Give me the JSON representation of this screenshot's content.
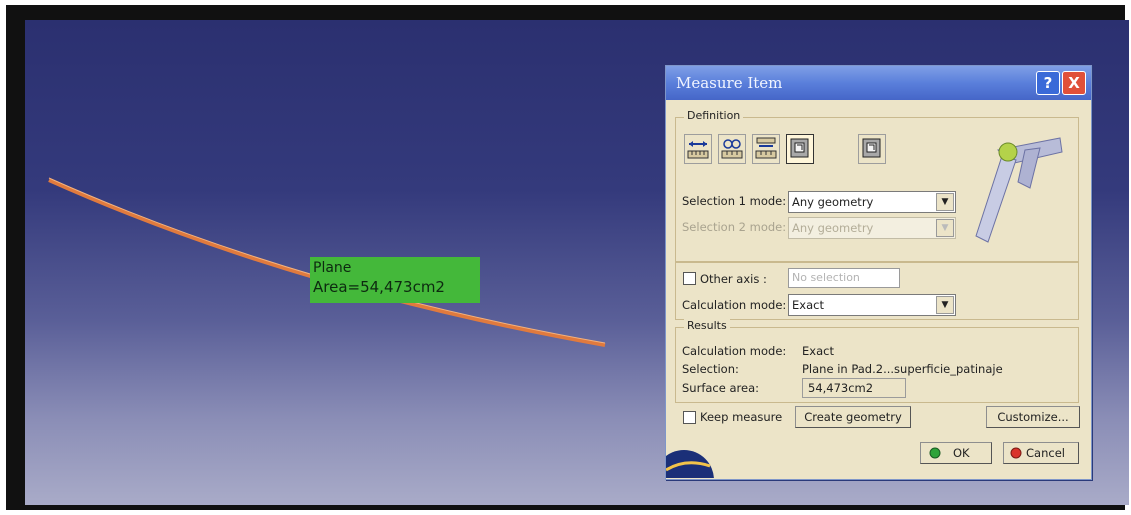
{
  "viewport": {
    "label": {
      "line1": "Plane",
      "line2": "Area=54,473cm2"
    }
  },
  "dialog": {
    "title": "Measure Item",
    "help_icon": "?",
    "close_icon": "X",
    "definition": {
      "legend": "Definition",
      "tools": [
        "measure-between-icon",
        "measure-item-icon",
        "measure-thickness-icon",
        "measure-surface-icon",
        "measure-inertia-icon"
      ],
      "selection1_label": "Selection 1 mode:",
      "selection1_value": "Any geometry",
      "selection2_label": "Selection 2 mode:",
      "selection2_value": "Any geometry",
      "other_axis_label": "Other axis :",
      "other_axis_value": "No selection",
      "calc_mode_label": "Calculation mode:",
      "calc_mode_value": "Exact"
    },
    "results": {
      "legend": "Results",
      "calc_mode_label": "Calculation mode:",
      "calc_mode_value": "Exact",
      "selection_label": "Selection:",
      "selection_value": "Plane in Pad.2...superficie_patinaje",
      "surface_area_label": "Surface area:",
      "surface_area_value": "54,473cm2"
    },
    "keep_measure_label": "Keep measure",
    "create_geometry_label": "Create geometry",
    "customize_label": "Customize...",
    "ok_label": "OK",
    "cancel_label": "Cancel"
  },
  "colors": {
    "accent": "#44b83a",
    "title_bar": "#5a7fdb",
    "dialog_bg": "#ece4c8",
    "curve": "#e07a3e"
  }
}
